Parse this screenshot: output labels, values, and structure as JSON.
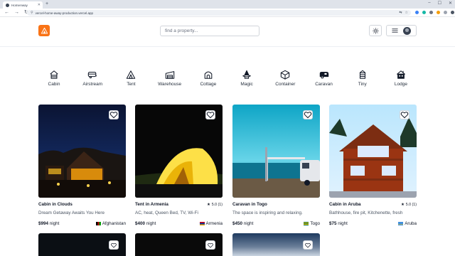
{
  "browser": {
    "tab_title": "HomeAway",
    "url": "vercel-home-away-production.vercel.app"
  },
  "header": {
    "search_placeholder": "find a property..."
  },
  "categories": [
    {
      "label": "Cabin",
      "icon": "cabin-icon"
    },
    {
      "label": "Airstream",
      "icon": "airstream-icon"
    },
    {
      "label": "Tent",
      "icon": "tent-icon"
    },
    {
      "label": "Warehouse",
      "icon": "warehouse-icon"
    },
    {
      "label": "Cottage",
      "icon": "cottage-icon"
    },
    {
      "label": "Magic",
      "icon": "magic-icon"
    },
    {
      "label": "Container",
      "icon": "container-icon"
    },
    {
      "label": "Caravan",
      "icon": "caravan-icon"
    },
    {
      "label": "Tiny",
      "icon": "tiny-icon"
    },
    {
      "label": "Lodge",
      "icon": "lodge-icon"
    }
  ],
  "properties": [
    {
      "title": "Cabin in Clouds",
      "rating": "",
      "tagline": "Dream Getaway Awaits You Here",
      "price": "$994",
      "price_unit": "night",
      "country": "Afghanistan"
    },
    {
      "title": "Tent in Armenia",
      "rating": "5.0 (1)",
      "tagline": "AC, heat, Queen Bed, TV, Wi-Fi",
      "price": "$400",
      "price_unit": "night",
      "country": "Armenia"
    },
    {
      "title": "Caravan in Togo",
      "rating": "",
      "tagline": "The space is inspiring and relaxing.",
      "price": "$450",
      "price_unit": "night",
      "country": "Togo"
    },
    {
      "title": "Cabin in Aruba",
      "rating": "5.0 (1)",
      "tagline": "Bathhouse, fire pit, Kitchenette, fresh",
      "price": "$75",
      "price_unit": "night",
      "country": "Aruba"
    }
  ],
  "colors": {
    "brand": "#f97316",
    "text": "#111827",
    "muted": "#4b5563"
  }
}
